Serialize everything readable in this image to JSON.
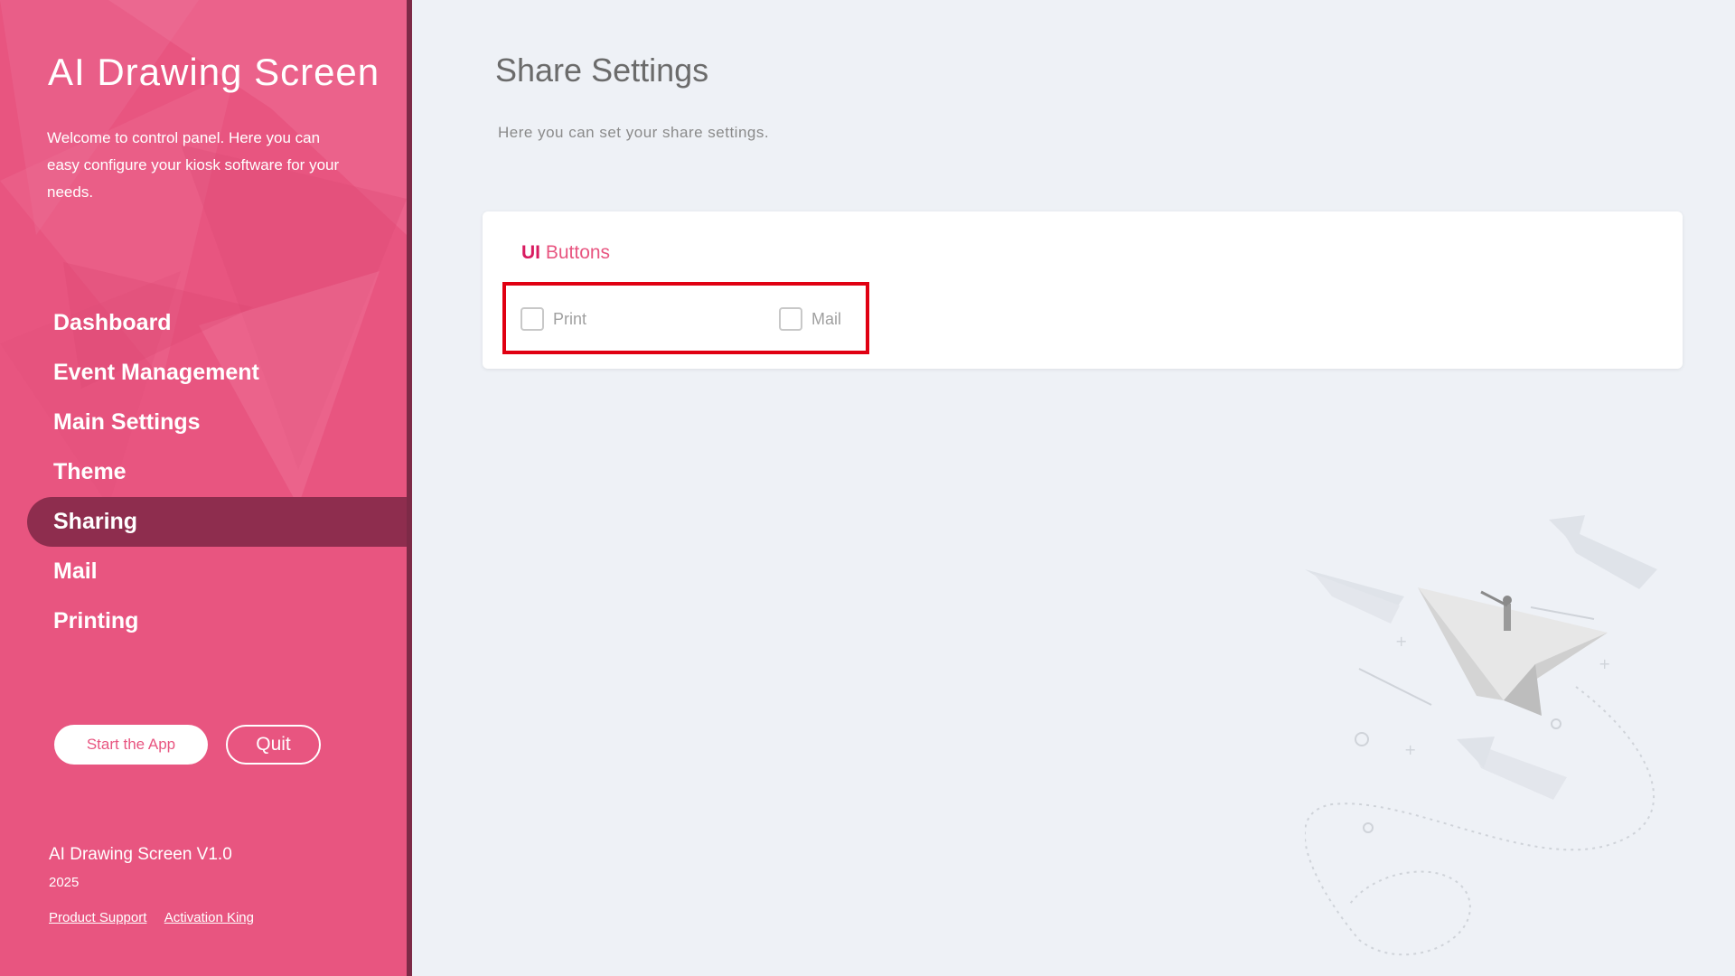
{
  "sidebar": {
    "title": "AI Drawing Screen",
    "description": "Welcome to control panel. Here you can easy configure your kiosk software for your needs.",
    "nav": [
      {
        "label": "Dashboard"
      },
      {
        "label": "Event Management"
      },
      {
        "label": "Main Settings"
      },
      {
        "label": "Theme"
      },
      {
        "label": "Sharing",
        "active": true
      },
      {
        "label": "Mail"
      },
      {
        "label": "Printing"
      }
    ],
    "start_button": "Start the App",
    "quit_button": "Quit",
    "version": "AI Drawing Screen V1.0",
    "year": "2025",
    "links": [
      "Product Support",
      "Activation King"
    ]
  },
  "main": {
    "title": "Share Settings",
    "subtitle": "Here you can set your share settings.",
    "card": {
      "title_prefix": "UI",
      "title_rest": " Buttons",
      "options": [
        {
          "label": "Print",
          "checked": false
        },
        {
          "label": "Mail",
          "checked": false
        }
      ]
    }
  },
  "colors": {
    "sidebar_bg": "#e85580",
    "active_nav": "#8e2d4e",
    "page_bg": "#eef1f6",
    "highlight_box": "#e00012"
  }
}
